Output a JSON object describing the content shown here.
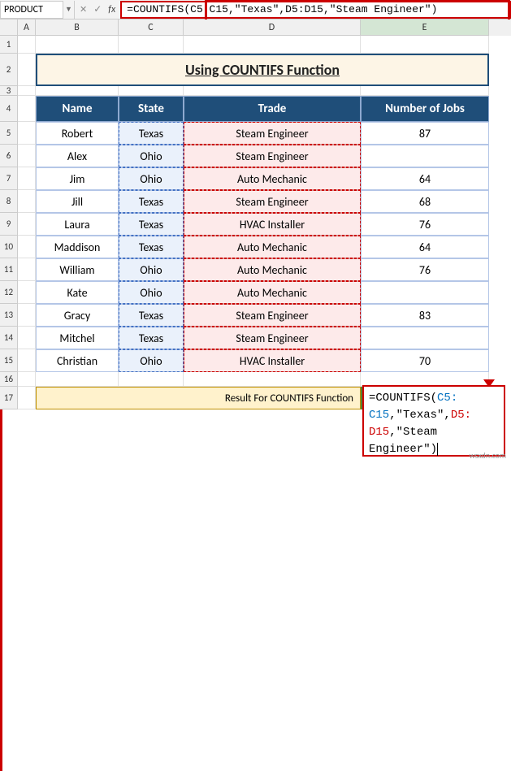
{
  "nameBox": "PRODUCT",
  "formulaBar": "=COUNTIFS(C5:C15,\"Texas\",D5:D15,\"Steam Engineer\")",
  "columns": [
    "A",
    "B",
    "C",
    "D",
    "E"
  ],
  "title": "Using COUNTIFS Function",
  "headers": {
    "name": "Name",
    "state": "State",
    "trade": "Trade",
    "jobs": "Number of Jobs"
  },
  "rows": [
    {
      "name": "Robert",
      "state": "Texas",
      "trade": "Steam Engineer",
      "jobs": "87"
    },
    {
      "name": "Alex",
      "state": "Ohio",
      "trade": "Steam Engineer",
      "jobs": ""
    },
    {
      "name": "Jim",
      "state": "Ohio",
      "trade": "Auto Mechanic",
      "jobs": "64"
    },
    {
      "name": "Jill",
      "state": "Texas",
      "trade": "Steam Engineer",
      "jobs": "68"
    },
    {
      "name": "Laura",
      "state": "Texas",
      "trade": "HVAC Installer",
      "jobs": "76"
    },
    {
      "name": "Maddison",
      "state": "Texas",
      "trade": "Auto Mechanic",
      "jobs": "64"
    },
    {
      "name": "William",
      "state": "Ohio",
      "trade": "Auto Mechanic",
      "jobs": "76"
    },
    {
      "name": "Kate",
      "state": "Ohio",
      "trade": "Auto Mechanic",
      "jobs": ""
    },
    {
      "name": "Gracy",
      "state": "Texas",
      "trade": "Steam Engineer",
      "jobs": "83"
    },
    {
      "name": "Mitchel",
      "state": "Texas",
      "trade": "Steam Engineer",
      "jobs": ""
    },
    {
      "name": "Christian",
      "state": "Ohio",
      "trade": "HVAC Installer",
      "jobs": "70"
    }
  ],
  "resultLabel": "Result For COUNTIFS Function",
  "formulaBox": {
    "p1": "=COUNTIFS(",
    "p2": "C5:",
    "p3": "C15",
    "p4": ",\"Texas\",",
    "p5": "D5:",
    "p6": "D15",
    "p7": ",\"Steam",
    "p8": "Engineer\")"
  },
  "watermark": "wsxdn.com"
}
